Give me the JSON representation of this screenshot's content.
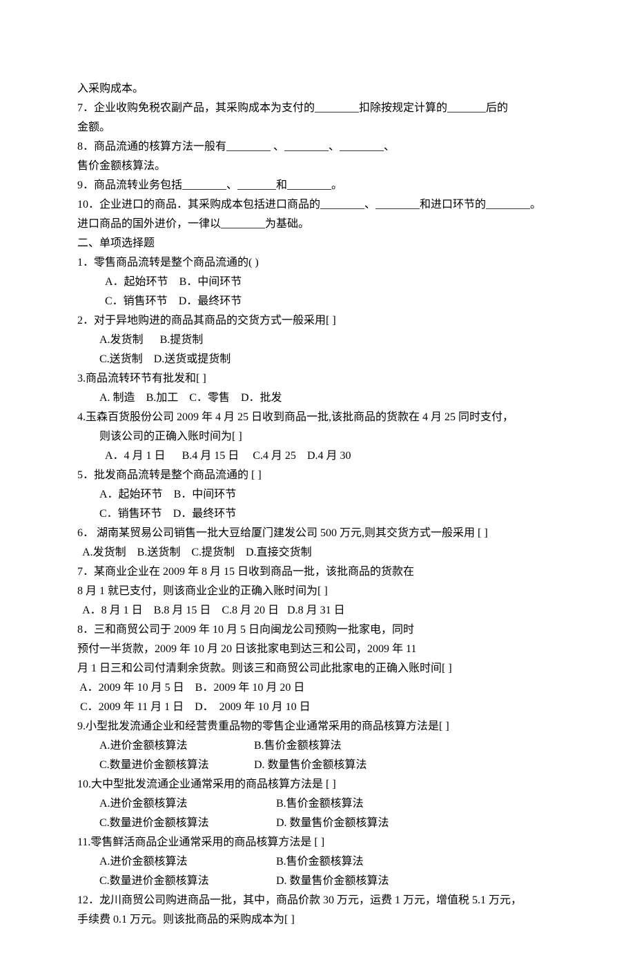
{
  "lines": {
    "p6_frag": "入采购成本。",
    "p7": "7．企业收购免税农副产品，其采购成本为支付的________扣除按规定计算的_______后的",
    "p7b": "金额。",
    "p8": "8．商品流通的核算方法一般有________ 、________、________、",
    "p8b": "售价金额核算法。",
    "p9": "9．商品流转业务包括________、_______和________。",
    "p10": "10．企业进口的商品．其采购成本包括进口商品的________、________和进口环节的________。",
    "p10b": "进口商品的国外进价，一律以________为基础。",
    "sec2_title": "二、单项选择题",
    "q1": {
      "stem": "1．零售商品流转是整个商品流通的(    )",
      "a": "A．起始环节",
      "b": "B．中间环节",
      "c": "C．销售环节",
      "d": "D．最终环节"
    },
    "q2": {
      "stem": "2．对于异地购进的商品其商品的交货方式一般采用[    ]",
      "a": "A.发货制",
      "b": "B.提货制",
      "c": "C.送货制",
      "d": "D.送货或提货制"
    },
    "q3": {
      "stem": "3.商品流转环节有批发和[    ]",
      "a": "A. 制造",
      "b": "B.加工",
      "c": "C．零售",
      "d": "D．批发"
    },
    "q4": {
      "stem": "4.玉森百货股份公司 2009 年 4 月 25 日收到商品一批,该批商品的货款在 4 月 25 同时支付，",
      "stem2": "则该公司的正确入账时间为[    ]",
      "a": "A．4 月 1 日",
      "b": "B.4 月 15 日",
      "c": "C.4 月 25",
      "d": "D.4 月 30"
    },
    "q5": {
      "stem": "5．批发商品流转是整个商品流通的  [    ]",
      "a": "A．起始环节",
      "b": "B．中间环节",
      "c": "C．销售环节",
      "d": "D．最终环节"
    },
    "q6": {
      "stem": "6． 湖南某贸易公司销售一批大豆给厦门建发公司 500 万元,则其交货方式一般采用 [    ]",
      "opts": "  A.发货制    B.送货制    C.提货制    D.直接交货制"
    },
    "q7": {
      "stem": "7．某商业企业在 2009 年 8 月 15 日收到商品一批，该批商品的货款在",
      "stem2": "8 月 1 就已支付，则该商业企业的正确入账时间为[    ]",
      "opts": "  A．8 月 1 日    B.8 月 15 日    C.8 月 20 日   D.8 月 31 日"
    },
    "q8": {
      "stem": "8．三和商贸公司于 2009 年 10 月 5 日向闽龙公司预购一批家电，同时",
      "stem2": "预付一半货款，2009 年 10 月 20 日该批家电到达三和公司，2009 年 11",
      "stem3": "月 1 日三和公司付清剩余货款。则该三和商贸公司此批家电的正确入账时间[    ]",
      "opts1": " A．2009 年 10 月 5 日    B．2009 年 10 月 20 日",
      "opts2": " C．2009 年 11 月 1 日    D．  2009 年 10 月 10 日"
    },
    "q9": {
      "stem": "9.小型批发流通企业和经营贵重品物的零售企业通常采用的商品核算方法是[    ]",
      "a": "A.进价金额核算法",
      "b": "B.售价金额核算法",
      "c": "C.数量进价金额核算法",
      "d": "D. 数量售价金额核算法"
    },
    "q10": {
      "stem": "10.大中型批发流通企业通常采用的商品核算方法是  [    ]",
      "a": "A.进价金额核算法",
      "b": "B.售价金额核算法",
      "c": "C.数量进价金额核算法",
      "d": "D. 数量售价金额核算法"
    },
    "q11": {
      "stem": "11.零售鲜活商品企业通常采用的商品核算方法是  [    ]",
      "a": "A.进价金额核算法",
      "b": "B.售价金额核算法",
      "c": "C.数量进价金额核算法",
      "d": "D. 数量售价金额核算法"
    },
    "q12": {
      "stem": "12．龙川商贸公司购进商品一批，其中，商品价款 30 万元，运费 1 万元，增值税 5.1 万元，",
      "stem2": "手续费 0.1 万元。则该批商品的采购成本为[    ]"
    }
  }
}
